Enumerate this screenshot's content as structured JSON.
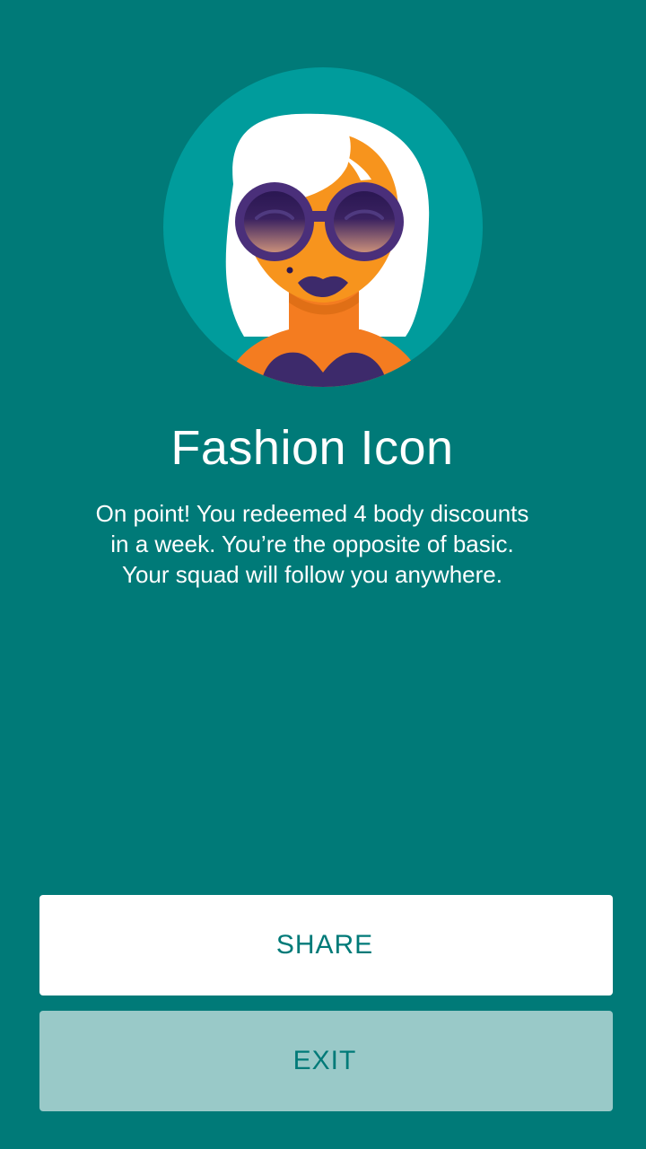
{
  "badge": {
    "title": "Fashion Icon",
    "description_lines": [
      "On point! You redeemed 4 body discounts",
      "in a week. You’re the opposite of basic.",
      "Your squad will follow you anywhere."
    ],
    "avatar_icon": "fashion-woman-sunglasses-icon"
  },
  "actions": {
    "share_label": "SHARE",
    "exit_label": "EXIT"
  },
  "colors": {
    "background": "#007a78",
    "avatar_circle": "#009c9c",
    "skin": "#f7941d",
    "hair": "#ffffff",
    "accent_purple": "#3d2a6b",
    "share_button_bg": "#ffffff",
    "exit_button_bg": "#99c9c8",
    "button_text": "#007a78"
  }
}
